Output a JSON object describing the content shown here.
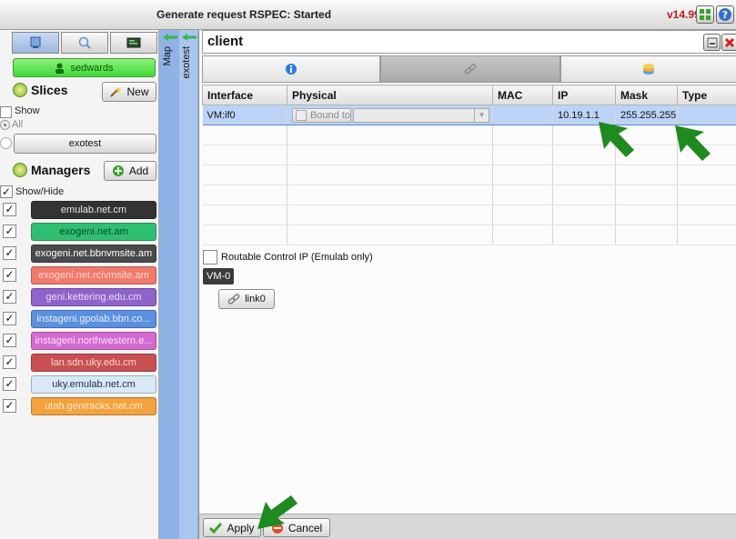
{
  "window": {
    "title": "Generate request RSPEC: Started",
    "version": "v14.99"
  },
  "sidebar": {
    "user": "sedwards",
    "slices": {
      "title": "Slices",
      "new_label": "New",
      "show_label": "Show",
      "all_label": "All",
      "slice_name": "exotest"
    },
    "managers": {
      "title": "Managers",
      "add_label": "Add",
      "show_hide_label": "Show/Hide",
      "items": [
        {
          "label": "emulab.net.cm",
          "bg": "#333333",
          "fg": "#e6e6e6",
          "checked": true
        },
        {
          "label": "exogeni.net.am",
          "bg": "#2fbf71",
          "fg": "#0b4a2a",
          "checked": true
        },
        {
          "label": "exogeni.net.bbnvmsite.am",
          "bg": "#4a4a4a",
          "fg": "#ffffff",
          "checked": true
        },
        {
          "label": "exogeni.net.rcivmsite.am",
          "bg": "#f07a6c",
          "fg": "#ffd7d0",
          "checked": true
        },
        {
          "label": "geni.kettering.edu.cm",
          "bg": "#8f63c9",
          "fg": "#e8dcf7",
          "checked": true
        },
        {
          "label": "instageni.gpolab.bbn.co...",
          "bg": "#5b8fe0",
          "fg": "#e8f0ff",
          "checked": true
        },
        {
          "label": "instageni.northwestern.e...",
          "bg": "#d46ad0",
          "fg": "#fde3fb",
          "checked": true
        },
        {
          "label": "lan.sdn.uky.edu.cm",
          "bg": "#c85050",
          "fg": "#ffd4d4",
          "checked": true
        },
        {
          "label": "uky.emulab.net.cm",
          "bg": "#d9e8f5",
          "fg": "#1c2f4a",
          "checked": true
        },
        {
          "label": "utah.geniracks.net.cm",
          "bg": "#f4a240",
          "fg": "#ffe7c4",
          "checked": true
        }
      ]
    }
  },
  "vertical_tabs": [
    {
      "label": "Map"
    },
    {
      "label": "exotest"
    }
  ],
  "node": {
    "name": "client",
    "tabs": [
      {
        "icon": "info-icon"
      },
      {
        "icon": "link-icon"
      },
      {
        "icon": "disk-image-icon"
      }
    ]
  },
  "interfaces": {
    "columns": [
      "Interface",
      "Physical",
      "MAC",
      "IP",
      "Mask",
      "Type"
    ],
    "rows": [
      {
        "interface": "VM:if0",
        "bound_label": "Bound to",
        "mac": "",
        "ip": "10.19.1.1",
        "mask": "255.255.255",
        "type": ""
      }
    ]
  },
  "routable_label": "Routable Control IP (Emulab only)",
  "vm_tag": "VM-0",
  "link_label": "link0",
  "footer": {
    "apply_label": "Apply",
    "cancel_label": "Cancel"
  },
  "colors": {
    "accent_blue": "#8fb3e6",
    "selected_row": "#bcd3f6",
    "annotation_arrow": "#1f8a1f"
  }
}
